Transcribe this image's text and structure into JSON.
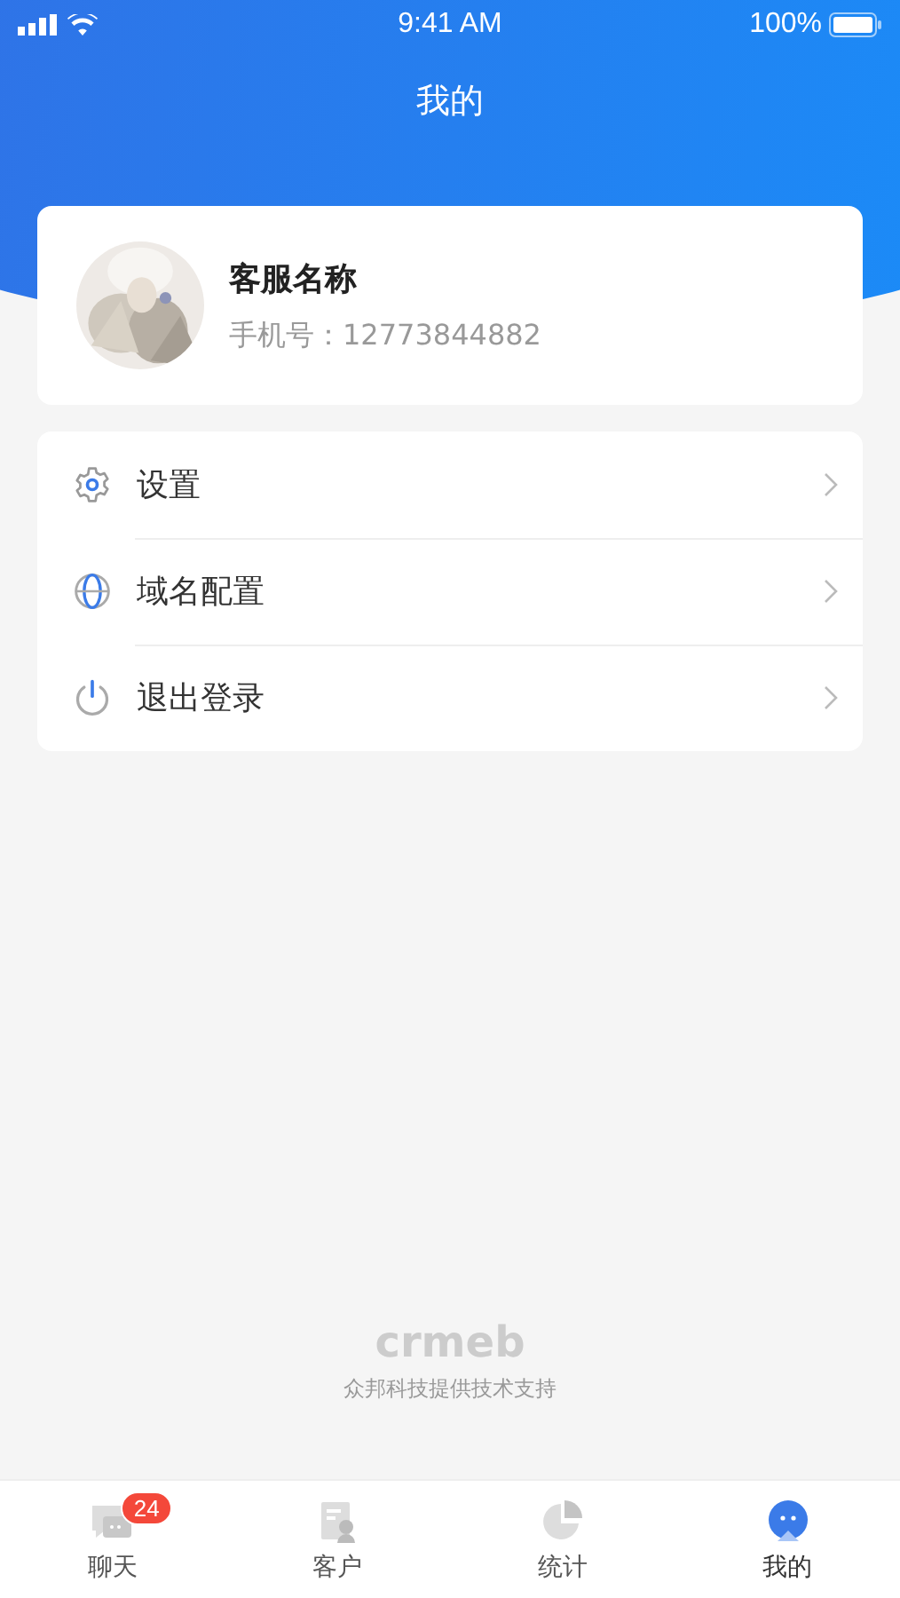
{
  "status_bar": {
    "time": "9:41 AM",
    "battery": "100%"
  },
  "header": {
    "title": "我的"
  },
  "profile": {
    "name": "客服名称",
    "phone": "手机号：12773844882"
  },
  "menu": [
    {
      "kind": "settings",
      "label": "设置"
    },
    {
      "kind": "domain",
      "label": "域名配置"
    },
    {
      "kind": "logout",
      "label": "退出登录"
    }
  ],
  "footer": {
    "logo": "crmeb",
    "credit": "众邦科技提供技术支持"
  },
  "tab_bar": [
    {
      "kind": "chat",
      "label": "聊天",
      "badge": "24",
      "selected": false
    },
    {
      "kind": "customer",
      "label": "客户",
      "selected": false
    },
    {
      "kind": "stats",
      "label": "统计",
      "selected": false
    },
    {
      "kind": "mine",
      "label": "我的",
      "selected": true
    }
  ]
}
